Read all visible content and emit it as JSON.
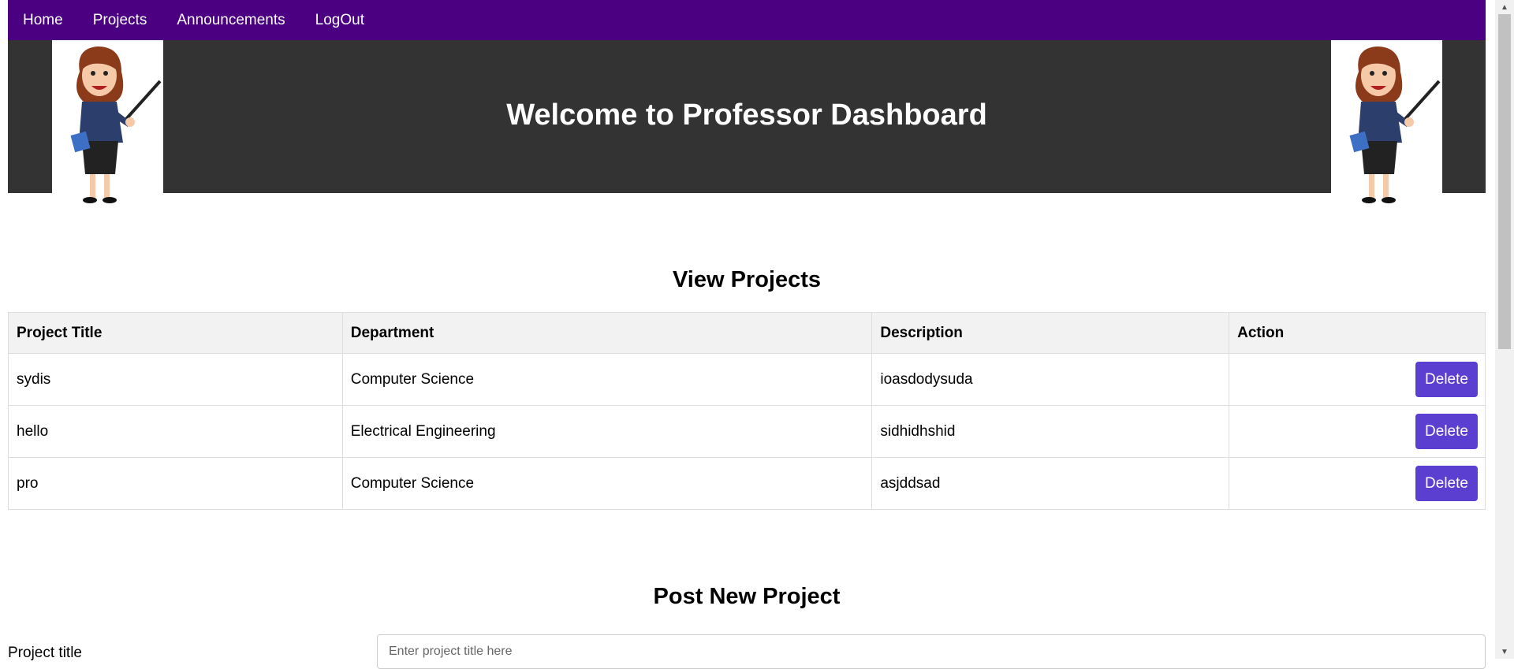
{
  "nav": {
    "items": [
      "Home",
      "Projects",
      "Announcements",
      "LogOut"
    ]
  },
  "banner": {
    "title": "Welcome to Professor Dashboard"
  },
  "view_projects": {
    "title": "View Projects",
    "columns": [
      "Project Title",
      "Department",
      "Description",
      "Action"
    ],
    "rows": [
      {
        "title": "sydis",
        "department": "Computer Science",
        "description": "ioasdodysuda",
        "action": "Delete"
      },
      {
        "title": "hello",
        "department": "Electrical Engineering",
        "description": "sidhidhshid",
        "action": "Delete"
      },
      {
        "title": "pro",
        "department": "Computer Science",
        "description": "asjddsad",
        "action": "Delete"
      }
    ]
  },
  "post_project": {
    "title": "Post New Project",
    "title_label": "Project title",
    "title_placeholder": "Enter project title here"
  },
  "colors": {
    "nav": "#4b0082",
    "banner": "#333333",
    "button": "#5b3fd1"
  }
}
